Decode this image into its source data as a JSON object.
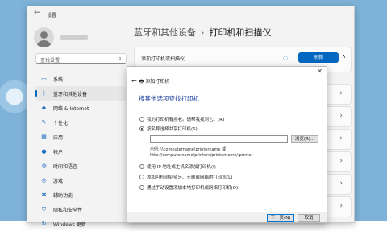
{
  "window": {
    "app_name": "设置"
  },
  "sidebar": {
    "search_placeholder": "查找设置",
    "items": [
      {
        "label": "系统",
        "icon": "system-icon"
      },
      {
        "label": "蓝牙和其他设备",
        "icon": "bluetooth-icon"
      },
      {
        "label": "网络 & Internet",
        "icon": "network-icon"
      },
      {
        "label": "个性化",
        "icon": "brush-icon"
      },
      {
        "label": "应用",
        "icon": "apps-icon"
      },
      {
        "label": "帐户",
        "icon": "account-icon"
      },
      {
        "label": "时间和语言",
        "icon": "globe-icon"
      },
      {
        "label": "游戏",
        "icon": "gamepad-icon"
      },
      {
        "label": "辅助功能",
        "icon": "accessibility-icon"
      },
      {
        "label": "隐私和安全性",
        "icon": "shield-icon"
      },
      {
        "label": "Windows 更新",
        "icon": "update-icon"
      }
    ]
  },
  "header": {
    "parent": "蓝牙和其他设备",
    "separator": "›",
    "current": "打印机和扫描仪"
  },
  "add_card": {
    "label": "添加打印机或扫描仪",
    "refresh_label": "刷新"
  },
  "dialog": {
    "window_title": "添加打印机",
    "heading": "按其他选项查找打印机",
    "options": [
      {
        "label": "我的打印机有点老。请帮我找到它。(R)",
        "selected": false
      },
      {
        "label": "按名称选择共享打印机(S)",
        "selected": true
      },
      {
        "label": "使用 IP 地址或主机名添加打印机(I)",
        "selected": false
      },
      {
        "label": "添加可检测到蓝牙、无线或网络的打印机(L)",
        "selected": false
      },
      {
        "label": "通过手动设置添加本地打印机或网络打印机(O)",
        "selected": false
      }
    ],
    "path_value": "",
    "browse_label": "浏览(R)...",
    "example_line1": "示例: \\\\computername\\printername 或",
    "example_line2": "http://computername/printers/printername/.printer",
    "next_label": "下一页(N)",
    "cancel_label": "取消"
  }
}
